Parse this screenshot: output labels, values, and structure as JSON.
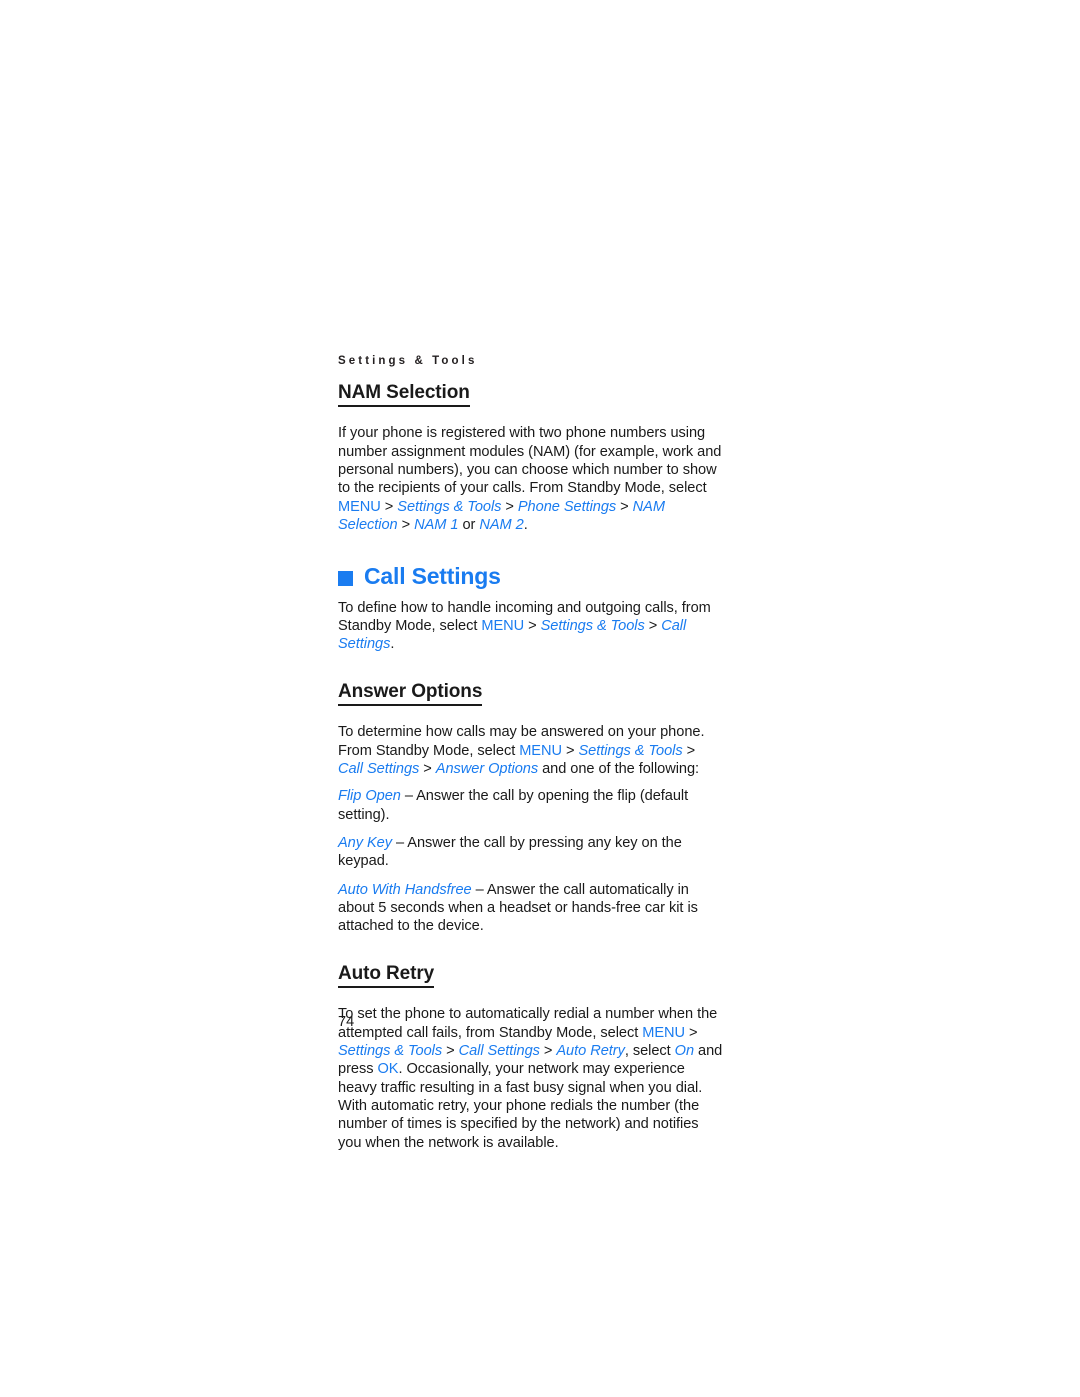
{
  "document": {
    "running_header": "Settings & Tools",
    "page_number": "74",
    "accent_color": "#1a7cf0",
    "text_color": "#1a1a1a",
    "background_color": "#ffffff"
  },
  "sections": {
    "nam_selection": {
      "heading": "NAM Selection",
      "paragraph_lead": "If your phone is registered with two phone numbers using number assignment modules (NAM) (for example, work and personal numbers), you can choose which number to show to the recipients of your calls. From Standby Mode, select ",
      "path": {
        "menu": "MENU",
        "sep": " > ",
        "settings_tools": "Settings & Tools",
        "phone_settings": "Phone Settings",
        "nam_selection": "NAM Selection",
        "nam_1": "NAM 1",
        "or": " or ",
        "nam_2": "NAM 2",
        "period": "."
      }
    },
    "call_settings": {
      "heading": "Call Settings",
      "bullet_icon": "square-bullet-icon",
      "paragraph_lead": "To define how to handle incoming and outgoing calls, from Standby Mode, select ",
      "path": {
        "menu": "MENU",
        "sep": " > ",
        "settings_tools": "Settings & Tools",
        "call_settings": "Call Settings",
        "period": "."
      }
    },
    "answer_options": {
      "heading": "Answer Options",
      "paragraph_lead": "To determine how calls may be answered on your phone. From Standby Mode, select ",
      "path": {
        "menu": "MENU",
        "sep": " > ",
        "settings_tools": "Settings & Tools",
        "call_settings": "Call Settings",
        "answer_options": "Answer Options"
      },
      "paragraph_tail": " and one of the following:",
      "options": [
        {
          "term": "Flip Open",
          "dash": " – ",
          "definition": "Answer the call by opening the flip (default setting)."
        },
        {
          "term": "Any Key",
          "dash": " – ",
          "definition": "Answer the call by pressing any key on the keypad."
        },
        {
          "term": "Auto With Handsfree",
          "dash": " – ",
          "definition": "Answer the call automatically in about 5 seconds when a headset or hands-free car kit is attached to the device."
        }
      ]
    },
    "auto_retry": {
      "heading": "Auto Retry",
      "paragraph_lead": "To set the phone to automatically redial a number when the attempted call fails, from Standby Mode, select ",
      "path": {
        "menu": "MENU",
        "sep": " > ",
        "settings_tools": "Settings & Tools",
        "call_settings": "Call Settings",
        "auto_retry": "Auto Retry",
        "select": ", select ",
        "on": "On",
        "and_press": " and press ",
        "ok": "OK",
        "period": "."
      },
      "paragraph_tail": " Occasionally, your network may experience heavy traffic resulting in a fast busy signal when you dial. With automatic retry, your phone redials the number (the number of times is specified by the network) and notifies you when the network is available."
    }
  }
}
